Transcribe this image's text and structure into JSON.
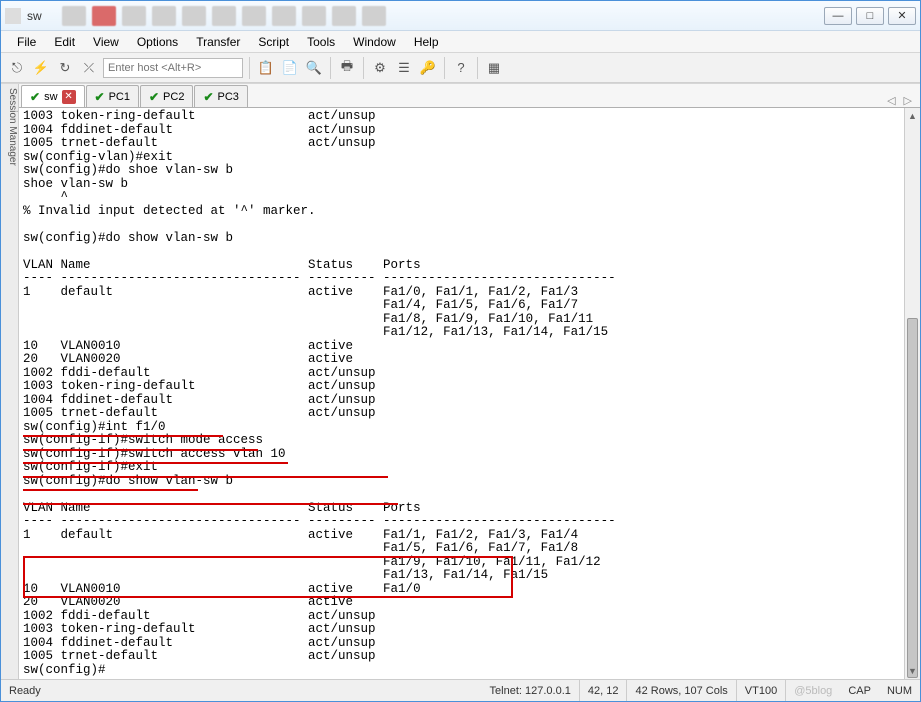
{
  "window": {
    "title": "sw"
  },
  "menu": [
    "File",
    "Edit",
    "View",
    "Options",
    "Transfer",
    "Script",
    "Tools",
    "Window",
    "Help"
  ],
  "toolbar": {
    "host_placeholder": "Enter host <Alt+R>"
  },
  "side": {
    "label": "Session Manager"
  },
  "tabs": [
    {
      "label": "sw",
      "active": true,
      "close": true
    },
    {
      "label": "PC1"
    },
    {
      "label": "PC2"
    },
    {
      "label": "PC3"
    }
  ],
  "terminal_text": "1003 token-ring-default               act/unsup\n1004 fddinet-default                  act/unsup\n1005 trnet-default                    act/unsup\nsw(config-vlan)#exit\nsw(config)#do shoe vlan-sw b\nshoe vlan-sw b\n     ^\n% Invalid input detected at '^' marker.\n\nsw(config)#do show vlan-sw b\n\nVLAN Name                             Status    Ports\n---- -------------------------------- --------- -------------------------------\n1    default                          active    Fa1/0, Fa1/1, Fa1/2, Fa1/3\n                                                Fa1/4, Fa1/5, Fa1/6, Fa1/7\n                                                Fa1/8, Fa1/9, Fa1/10, Fa1/11\n                                                Fa1/12, Fa1/13, Fa1/14, Fa1/15\n10   VLAN0010                         active\n20   VLAN0020                         active\n1002 fddi-default                     act/unsup\n1003 token-ring-default               act/unsup\n1004 fddinet-default                  act/unsup\n1005 trnet-default                    act/unsup\nsw(config)#int f1/0\nsw(config-if)#switch mode access\nsw(config-if)#switch access vlan 10\nsw(config-if)#exit\nsw(config)#do show vlan-sw b\n\nVLAN Name                             Status    Ports\n---- -------------------------------- --------- -------------------------------\n1    default                          active    Fa1/1, Fa1/2, Fa1/3, Fa1/4\n                                                Fa1/5, Fa1/6, Fa1/7, Fa1/8\n                                                Fa1/9, Fa1/10, Fa1/11, Fa1/12\n                                                Fa1/13, Fa1/14, Fa1/15\n10   VLAN0010                         active    Fa1/0\n20   VLAN0020                         active\n1002 fddi-default                     act/unsup\n1003 token-ring-default               act/unsup\n1004 fddinet-default                  act/unsup\n1005 trnet-default                    act/unsup\nsw(config)#",
  "status": {
    "ready": "Ready",
    "conn": "Telnet: 127.0.0.1",
    "cursor": "42,  12",
    "size": "42 Rows, 107 Cols",
    "emu": "VT100",
    "cap": "CAP",
    "num": "NUM"
  },
  "watermark": "@5blog"
}
